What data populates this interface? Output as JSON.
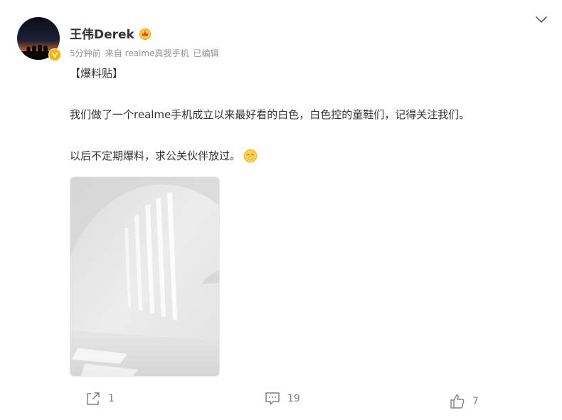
{
  "post": {
    "author": "王伟Derek",
    "meta": {
      "time": "5分钟前",
      "source_prefix": "来自",
      "source": "realme真我手机",
      "edited": "已编辑"
    },
    "body": {
      "line1": "【爆料贴】",
      "line2": "我们做了一个realme手机成立以来最好看的白色，白色控的童鞋们，记得关注我们。",
      "line3": "以后不定期爆料，求公关伙伴放过。"
    }
  },
  "actions": {
    "repost_count": "1",
    "comment_count": "19",
    "like_count": "7"
  },
  "colors": {
    "accent": "#f7b500",
    "text": "#333333",
    "muted": "#939393",
    "icon": "#808080"
  },
  "icons": [
    "verified-icon",
    "crown-badge-icon",
    "chevron-down-icon",
    "begging-emoji-icon",
    "repost-icon",
    "comment-icon",
    "like-icon"
  ]
}
